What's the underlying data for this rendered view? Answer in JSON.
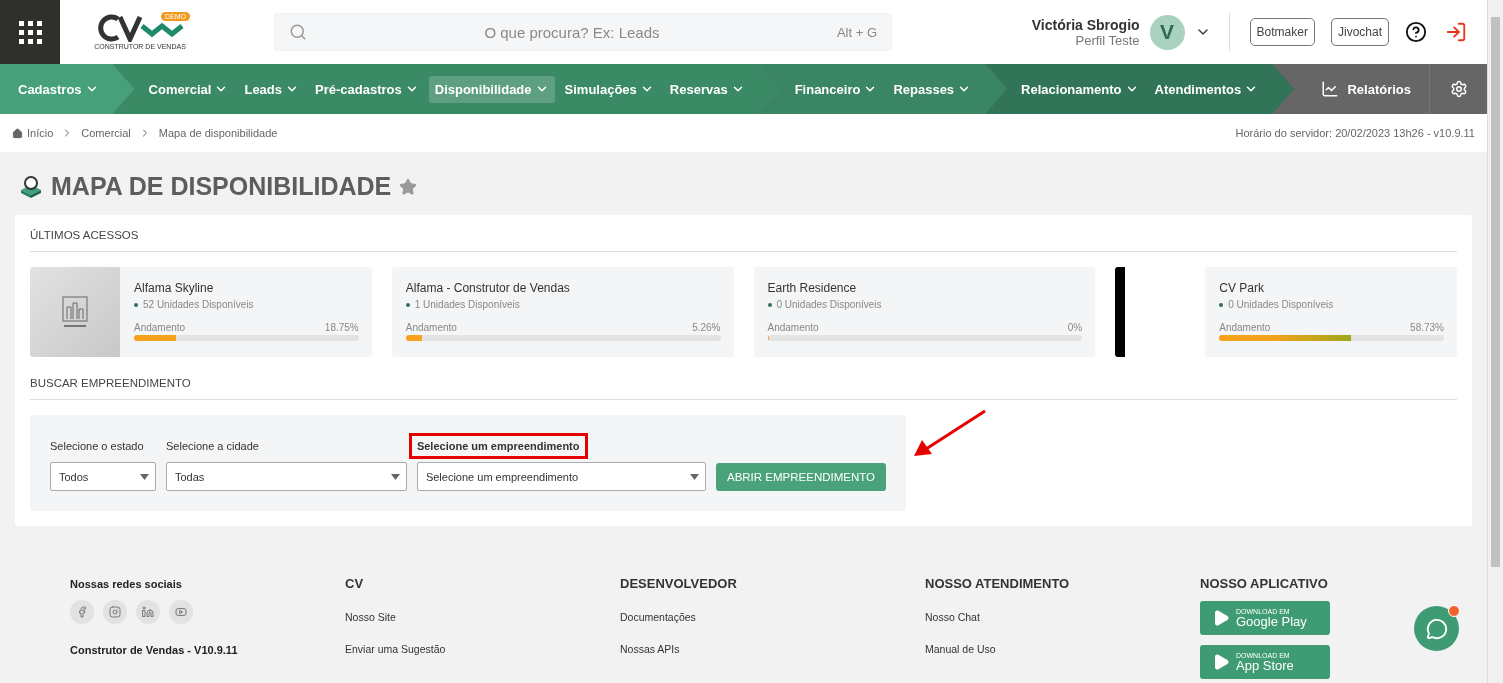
{
  "header": {
    "logo_badge": "DEMO",
    "logo_caption": "CONSTRUTOR DE VENDAS",
    "search": {
      "placeholder": "O que procura? Ex: Leads",
      "shortcut": "Alt + G"
    },
    "user": {
      "name": "Victória Sbrogio",
      "profile": "Perfil Teste",
      "initial": "V"
    },
    "buttons": [
      "Botmaker",
      "Jivochat"
    ]
  },
  "nav": {
    "groups": [
      {
        "items": [
          {
            "label": "Cadastros",
            "selected": false
          }
        ]
      },
      {
        "items": [
          {
            "label": "Comercial",
            "selected": false
          },
          {
            "label": "Leads",
            "selected": false
          },
          {
            "label": "Pré-cadastros",
            "selected": false
          },
          {
            "label": "Disponibilidade",
            "selected": true
          },
          {
            "label": "Simulações",
            "selected": false
          },
          {
            "label": "Reservas",
            "selected": false
          }
        ]
      },
      {
        "items": [
          {
            "label": "Financeiro",
            "selected": false
          },
          {
            "label": "Repasses",
            "selected": false
          }
        ]
      },
      {
        "items": [
          {
            "label": "Relacionamento",
            "selected": false
          },
          {
            "label": "Atendimentos",
            "selected": false
          }
        ]
      }
    ],
    "reports": "Relatórios"
  },
  "breadcrumb": [
    "Início",
    "Comercial",
    "Mapa de disponibilidade"
  ],
  "server_time": "Horário do servidor: 20/02/2023 13h26 - v10.9.11",
  "page_title": "MAPA DE DISPONIBILIDADE",
  "recent": {
    "title": "ÚLTIMOS ACESSOS",
    "items": [
      {
        "kind": "logo",
        "name": "Alfama Skyline",
        "units": "52 Unidades Disponíveis",
        "progress_label": "Andamento",
        "percent": "18.75%",
        "level": 0.1875
      },
      {
        "kind": "plain",
        "name": "Alfama - Construtor de Vendas",
        "units": "1 Unidades Disponíveis",
        "progress_label": "Andamento",
        "percent": "5.26%",
        "level": 0.0526
      },
      {
        "kind": "plain",
        "name": "Earth Residence",
        "units": "0 Unidades Disponíveis",
        "progress_label": "Andamento",
        "percent": "0%",
        "level": 0
      },
      {
        "kind": "photo",
        "name": "CV Park",
        "units": "0 Unidades Disponíveis",
        "progress_label": "Andamento",
        "percent": "58.73%",
        "level": 0.5873
      }
    ]
  },
  "search_section": {
    "title": "BUSCAR EMPREENDIMENTO",
    "fields": [
      {
        "label": "Selecione o estado",
        "value": "Todos",
        "highlighted": false
      },
      {
        "label": "Selecione a cidade",
        "value": "Todas",
        "highlighted": false
      },
      {
        "label": "Selecione um empreendimento",
        "value": "Selecione um empreendimento",
        "highlighted": true
      }
    ],
    "button": "ABRIR EMPREENDIMENTO"
  },
  "footer": {
    "social_title": "Nossas redes sociais",
    "version": "Construtor de Vendas - V10.9.11",
    "columns": [
      {
        "title": "CV",
        "links": [
          "Nosso Site",
          "Enviar uma Sugestão"
        ]
      },
      {
        "title": "DESENVOLVEDOR",
        "links": [
          "Documentações",
          "Nossas APIs"
        ]
      },
      {
        "title": "NOSSO ATENDIMENTO",
        "links": [
          "Nosso Chat",
          "Manual de Uso"
        ]
      }
    ],
    "app_title": "NOSSO APLICATIVO",
    "stores": [
      {
        "small": "DOWNLOAD EM",
        "name": "Google Play"
      },
      {
        "small": "DOWNLOAD EM",
        "name": "App Store"
      }
    ]
  },
  "chat": {
    "notification": true
  }
}
